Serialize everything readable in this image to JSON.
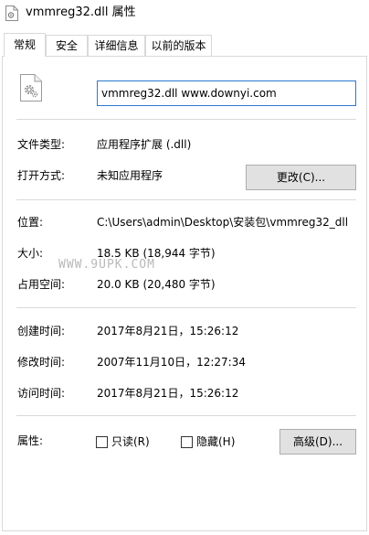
{
  "window": {
    "title": "vmmreg32.dll 属性"
  },
  "tabs": [
    {
      "label": "常规",
      "active": true
    },
    {
      "label": "安全",
      "active": false
    },
    {
      "label": "详细信息",
      "active": false
    },
    {
      "label": "以前的版本",
      "active": false
    }
  ],
  "general": {
    "file_name": "vmmreg32.dll www.downyi.com",
    "file_type_label": "文件类型:",
    "file_type_value": "应用程序扩展 (.dll)",
    "open_with_label": "打开方式:",
    "open_with_value": "未知应用程序",
    "change_button": "更改(C)...",
    "location_label": "位置:",
    "location_value": "C:\\Users\\admin\\Desktop\\安装包\\vmmreg32_dll",
    "size_label": "大小:",
    "size_value": "18.5 KB (18,944 字节)",
    "size_on_disk_label": "占用空间:",
    "size_on_disk_value": "20.0 KB (20,480 字节)",
    "created_label": "创建时间:",
    "created_value": "2017年8月21日，15:26:12",
    "modified_label": "修改时间:",
    "modified_value": "2007年11月10日，12:27:34",
    "accessed_label": "访问时间:",
    "accessed_value": "2017年8月21日，15:26:12",
    "attributes_label": "属性:",
    "readonly_label": "只读(R)",
    "readonly_checked": false,
    "hidden_label": "隐藏(H)",
    "hidden_checked": false,
    "advanced_button": "高级(D)..."
  },
  "watermark": {
    "text": "WWW.9UPK.COM"
  },
  "colors": {
    "input_focus_border": "#2a7ad4",
    "button_bg": "#e1e1e1",
    "separator": "#d9d9d9"
  },
  "icons": {
    "title_icon": "dll-file-icon",
    "file_icon": "dll-file-gear-icon"
  }
}
